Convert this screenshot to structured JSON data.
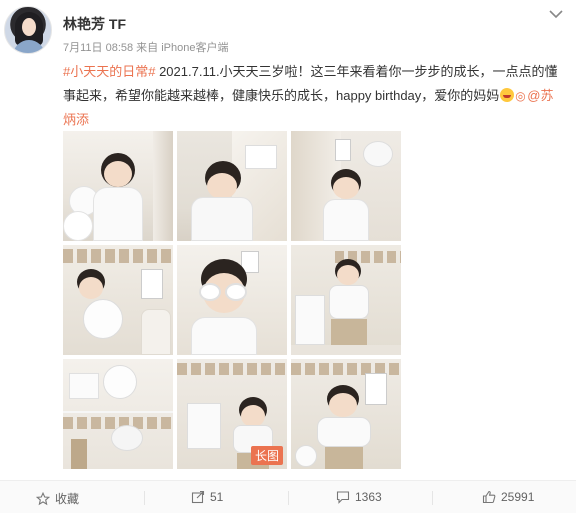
{
  "post": {
    "author": "林艳芳 TF",
    "meta": "7月11日 08:58 来自 iPhone客户端",
    "hashtag": "#小天天的日常#",
    "text_body": " 2021.7.11.小天天三岁啦！这三年来看着你一步步的成长，一点点的懂事起来，希望你能越来越棒，健康快乐的成长，happy birthday，爱你的妈妈",
    "mention": "@苏炳添",
    "long_image_badge": "长图"
  },
  "actions": {
    "favorite": "收藏",
    "repost": "51",
    "comment": "1363",
    "like": "25991"
  },
  "icons": {
    "more": "chevron-down-icon",
    "favorite": "star-icon",
    "repost": "share-icon",
    "comment": "comment-icon",
    "like": "thumbs-up-icon"
  },
  "colors": {
    "accent": "#eb7350",
    "text": "#333333",
    "meta": "#939393"
  }
}
